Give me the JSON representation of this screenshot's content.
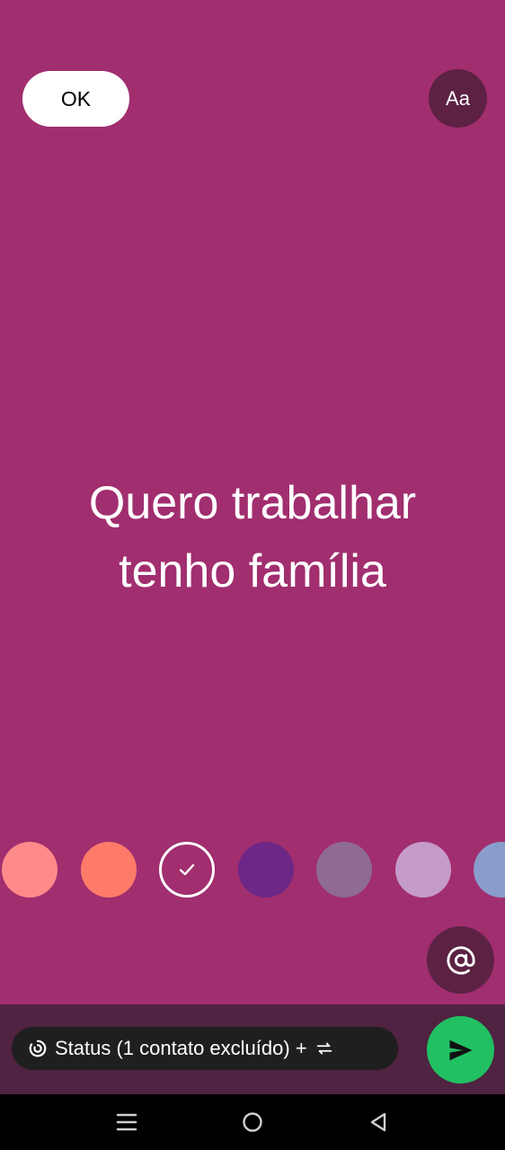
{
  "editor": {
    "background_color": "#a12e6f",
    "ok_label": "OK",
    "font_toggle_label": "Aa",
    "font_toggle_color": "#5c2143",
    "status_lines": [
      "Quero trabalhar",
      "tenho família"
    ]
  },
  "color_palette": {
    "swatches": [
      {
        "color": "#ff8a8a",
        "selected": false
      },
      {
        "color": "#ff7b69",
        "selected": false
      },
      {
        "color": "#a12e6f",
        "selected": true
      },
      {
        "color": "#6d2786",
        "selected": false
      },
      {
        "color": "#8f6b93",
        "selected": false
      },
      {
        "color": "#c59bc9",
        "selected": false
      },
      {
        "color": "#8a9ccc",
        "selected": false
      }
    ],
    "check_icon": "check-icon"
  },
  "mention": {
    "icon": "at-sign-icon",
    "background": "#5c2143"
  },
  "bottom_bar": {
    "background": "#4f2341",
    "audience_label": "Status (1 contato excluído) +",
    "audience_icon": "status-ring-icon",
    "swap_icon": "repeat-icon",
    "send_icon": "send-icon",
    "send_color": "#21c063"
  },
  "system_nav": {
    "items": [
      "recents-icon",
      "home-icon",
      "back-icon"
    ]
  }
}
